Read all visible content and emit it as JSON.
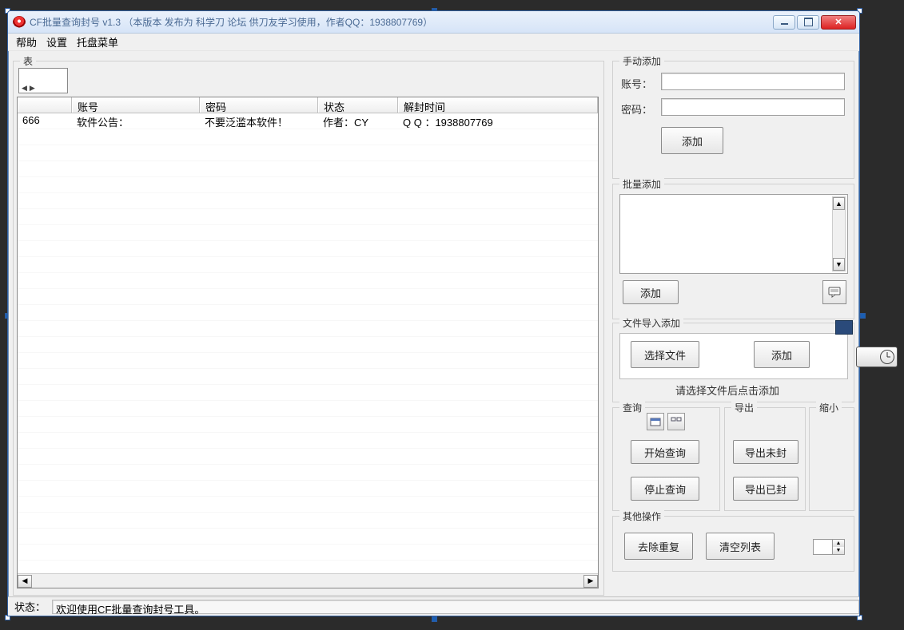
{
  "window": {
    "title": "CF批量查询封号 v1.3  （本版本 发布为 科学刀 论坛 供刀友学习使用，作者QQ：1938807769）"
  },
  "menu": {
    "help": "帮助",
    "settings": "设置",
    "tray": "托盘菜单"
  },
  "left": {
    "group_title": "表",
    "columns": {
      "c0": "",
      "c1": "账号",
      "c2": "密码",
      "c3": "状态",
      "c4": "解封时间"
    },
    "row1": {
      "c0": "666",
      "c1": "软件公告：",
      "c2": "不要泛滥本软件！",
      "c3": "作者：CY",
      "c4": "Q Q ：1938807769"
    }
  },
  "manual": {
    "title": "手动添加",
    "account_lbl": "账号：",
    "password_lbl": "密码：",
    "add_btn": "添加"
  },
  "batch": {
    "title": "批量添加",
    "add_btn": "添加"
  },
  "file": {
    "title": "文件导入添加",
    "choose_btn": "选择文件",
    "add_btn": "添加",
    "hint": "请选择文件后点击添加"
  },
  "query": {
    "title": "查询",
    "start": "开始查询",
    "stop": "停止查询"
  },
  "export_": {
    "title": "导出",
    "unbanned": "导出未封",
    "banned": "导出已封"
  },
  "shrink": {
    "title": "缩小"
  },
  "other": {
    "title": "其他操作",
    "dedup": "去除重复",
    "clear": "清空列表"
  },
  "status": {
    "label": "状态：",
    "text": "欢迎使用CF批量查询封号工具。"
  }
}
